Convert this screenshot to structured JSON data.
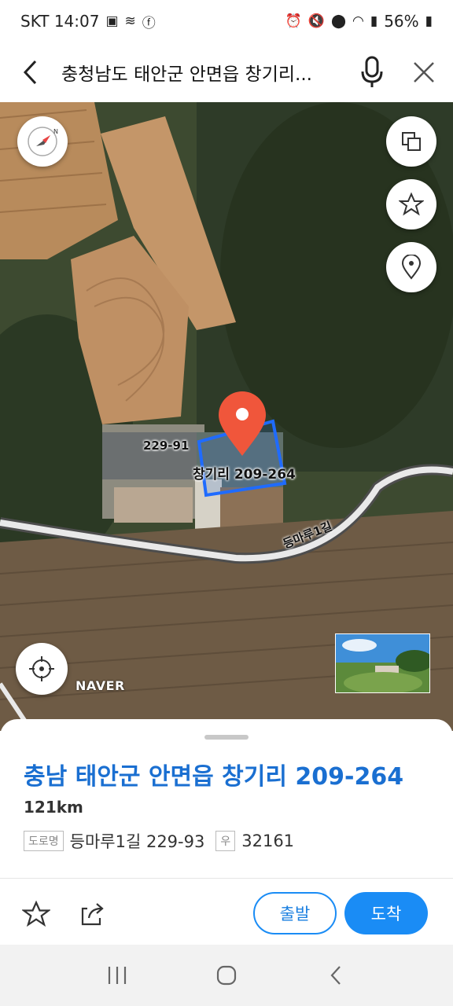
{
  "status": {
    "carrier_time": "SKT 14:07",
    "battery": "56%",
    "left_icons": [
      "gallery-icon",
      "sound-wave-icon",
      "facebook-icon"
    ],
    "right_icons": [
      "alarm-icon",
      "mute-icon",
      "location-icon",
      "wifi-icon",
      "signal-icon",
      "battery-icon"
    ]
  },
  "search": {
    "query": "충청남도 태안군 안면읍 창기리..."
  },
  "map": {
    "parcel_label": "229-91",
    "selected_label": "창기리 209-264",
    "road_label": "등마루1길",
    "logo": "NAVER"
  },
  "place": {
    "title": "충남 태안군 안면읍 창기리 209-264",
    "distance": "121km",
    "road_tag": "도로명",
    "road_address": "등마루1길 229-93",
    "zip_tag": "우",
    "zip": "32161"
  },
  "actions": {
    "departure": "출발",
    "arrival": "도착"
  },
  "colors": {
    "accent": "#1a8cf5",
    "title": "#1a6fd1",
    "pin": "#f0563b"
  }
}
